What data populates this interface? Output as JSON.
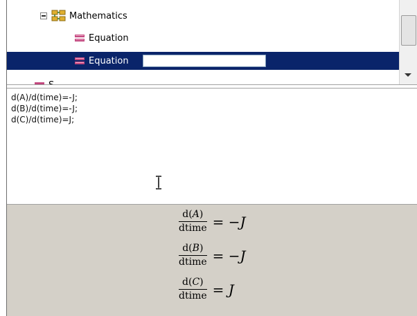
{
  "tree": {
    "parent_label": "Mathematics",
    "parent_icon": "math-node-icon",
    "items": [
      {
        "label": "Equation",
        "icon": "equation-icon",
        "selected": false
      },
      {
        "label": "Equation",
        "icon": "equation-icon",
        "selected": true,
        "rename_value": ""
      }
    ],
    "partial_label": "S"
  },
  "editor": {
    "lines": [
      "d(A)/d(time)=-J;",
      "d(B)/d(time)=-J;",
      "d(C)/d(time)=J;"
    ]
  },
  "render": {
    "equations": [
      {
        "num_pre": "d(",
        "var": "A",
        "num_post": ")",
        "den": "dtime",
        "rhs_sign": "= −",
        "rhs_var": "J"
      },
      {
        "num_pre": "d(",
        "var": "B",
        "num_post": ")",
        "den": "dtime",
        "rhs_sign": "= −",
        "rhs_var": "J"
      },
      {
        "num_pre": "d(",
        "var": "C",
        "num_post": ")",
        "den": "dtime",
        "rhs_sign": "= ",
        "rhs_var": "J"
      }
    ]
  },
  "colors": {
    "selection": "#0a246a",
    "render_bg": "#d4d0c8",
    "equation_icon": "#c2477e",
    "math_icon": "#c8a020"
  }
}
